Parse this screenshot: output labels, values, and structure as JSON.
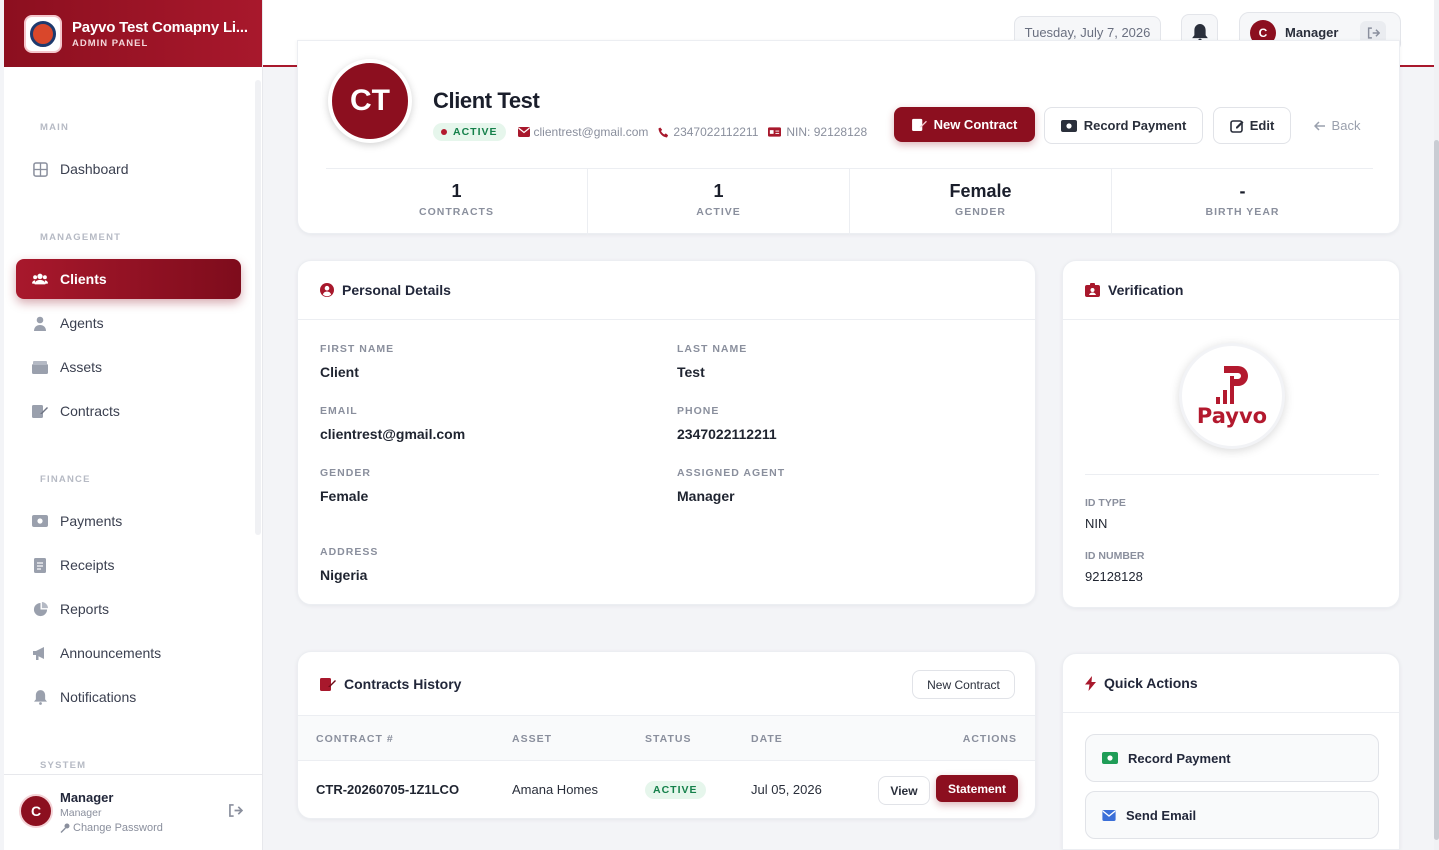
{
  "brand": {
    "name": "Payvo Test Comapny Li...",
    "subtitle": "ADMIN PANEL"
  },
  "sidebar": {
    "sections": {
      "main": "MAIN",
      "management": "MANAGEMENT",
      "finance": "FINANCE",
      "system": "SYSTEM"
    },
    "items": {
      "dashboard": "Dashboard",
      "clients": "Clients",
      "agents": "Agents",
      "assets": "Assets",
      "contracts": "Contracts",
      "payments": "Payments",
      "receipts": "Receipts",
      "reports": "Reports",
      "announcements": "Announcements",
      "notifications": "Notifications"
    },
    "user": {
      "initial": "C",
      "name": "Manager",
      "role": "Manager",
      "change_password": "Change Password"
    }
  },
  "header": {
    "date": "Tuesday, July 7, 2026",
    "user_initial": "C",
    "user_name": "Manager"
  },
  "profile": {
    "initials": "CT",
    "name": "Client Test",
    "status": "ACTIVE",
    "email": "clientrest@gmail.com",
    "phone": "2347022112211",
    "nin": "NIN: 92128128",
    "actions": {
      "new_contract": "New Contract",
      "record_payment": "Record Payment",
      "edit": "Edit",
      "back": "Back"
    },
    "stats": [
      {
        "value": "1",
        "label": "CONTRACTS"
      },
      {
        "value": "1",
        "label": "ACTIVE"
      },
      {
        "value": "Female",
        "label": "GENDER"
      },
      {
        "value": "-",
        "label": "BIRTH YEAR"
      }
    ]
  },
  "personal": {
    "title": "Personal Details",
    "first_name_label": "FIRST NAME",
    "first_name": "Client",
    "last_name_label": "LAST NAME",
    "last_name": "Test",
    "email_label": "EMAIL",
    "email": "clientrest@gmail.com",
    "phone_label": "PHONE",
    "phone": "2347022112211",
    "gender_label": "GENDER",
    "gender": "Female",
    "agent_label": "ASSIGNED AGENT",
    "agent": "Manager",
    "address_label": "ADDRESS",
    "address": "Nigeria"
  },
  "verification": {
    "title": "Verification",
    "logo_text": "Payvo",
    "id_type_label": "ID TYPE",
    "id_type": "NIN",
    "id_number_label": "ID NUMBER",
    "id_number": "92128128"
  },
  "contracts": {
    "title": "Contracts History",
    "new_button": "New Contract",
    "columns": [
      "CONTRACT #",
      "ASSET",
      "STATUS",
      "DATE",
      "ACTIONS"
    ],
    "rows": [
      {
        "number": "CTR-20260705-1Z1LCO",
        "asset": "Amana Homes",
        "status": "ACTIVE",
        "date": "Jul 05, 2026",
        "view": "View",
        "statement": "Statement"
      }
    ]
  },
  "quick_actions": {
    "title": "Quick Actions",
    "record_payment": "Record Payment",
    "send_email": "Send Email"
  },
  "colors": {
    "brand": "#8c0f1f",
    "accent": "#a8182c",
    "success": "#14804a"
  }
}
